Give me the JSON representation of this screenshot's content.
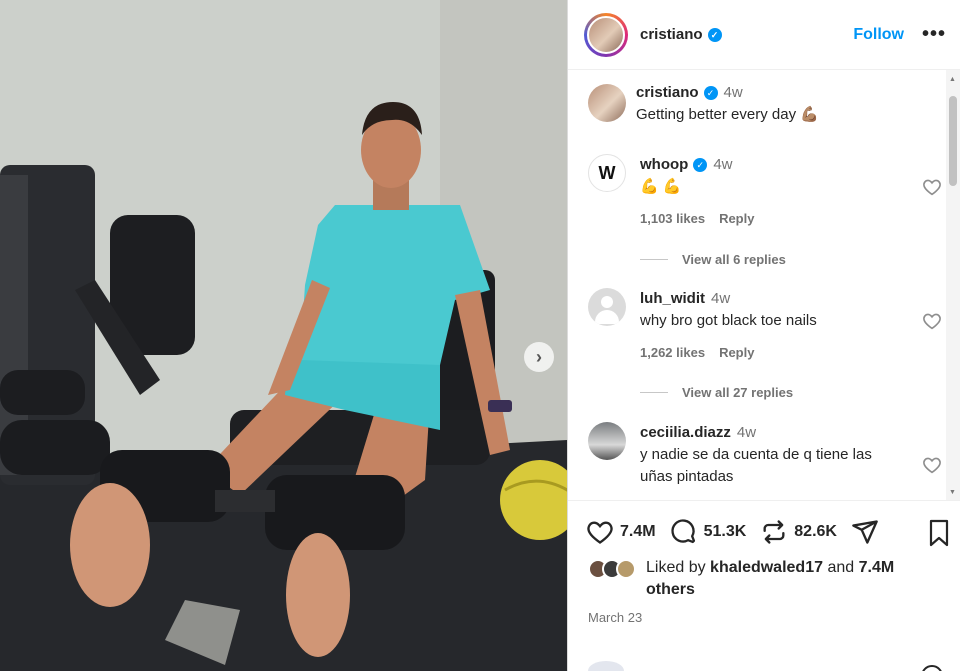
{
  "header": {
    "username": "cristiano",
    "follow_label": "Follow",
    "more_label": "•••"
  },
  "caption": {
    "username": "cristiano",
    "time": "4w",
    "text": "Getting better every day 💪🏽"
  },
  "comments": [
    {
      "username": "whoop",
      "verified": true,
      "time": "4w",
      "text": "💪 💪",
      "likes": "1,103 likes",
      "reply_label": "Reply",
      "view_replies": "View all 6 replies",
      "avatar_glyph": "W"
    },
    {
      "username": "luh_widit",
      "verified": false,
      "time": "4w",
      "text": "why bro got black toe nails",
      "likes": "1,262 likes",
      "reply_label": "Reply",
      "view_replies": "View all 27 replies"
    },
    {
      "username": "ceciilia.diazz",
      "verified": false,
      "time": "4w",
      "text": "y nadie se da cuenta de q tiene las uñas pintadas"
    }
  ],
  "actions": {
    "likes_count": "7.4M",
    "comments_count": "51.3K",
    "reposts_count": "82.6K"
  },
  "liked_by": {
    "prefix": "Liked by",
    "user": "khaledwaled17",
    "middle": "and",
    "count": "7.4M",
    "suffix": "others"
  },
  "post_date": "March 23",
  "media": {
    "next_arrow": "›"
  },
  "colors": {
    "accent": "#0095f6",
    "shirt": "#3fc1c9"
  }
}
